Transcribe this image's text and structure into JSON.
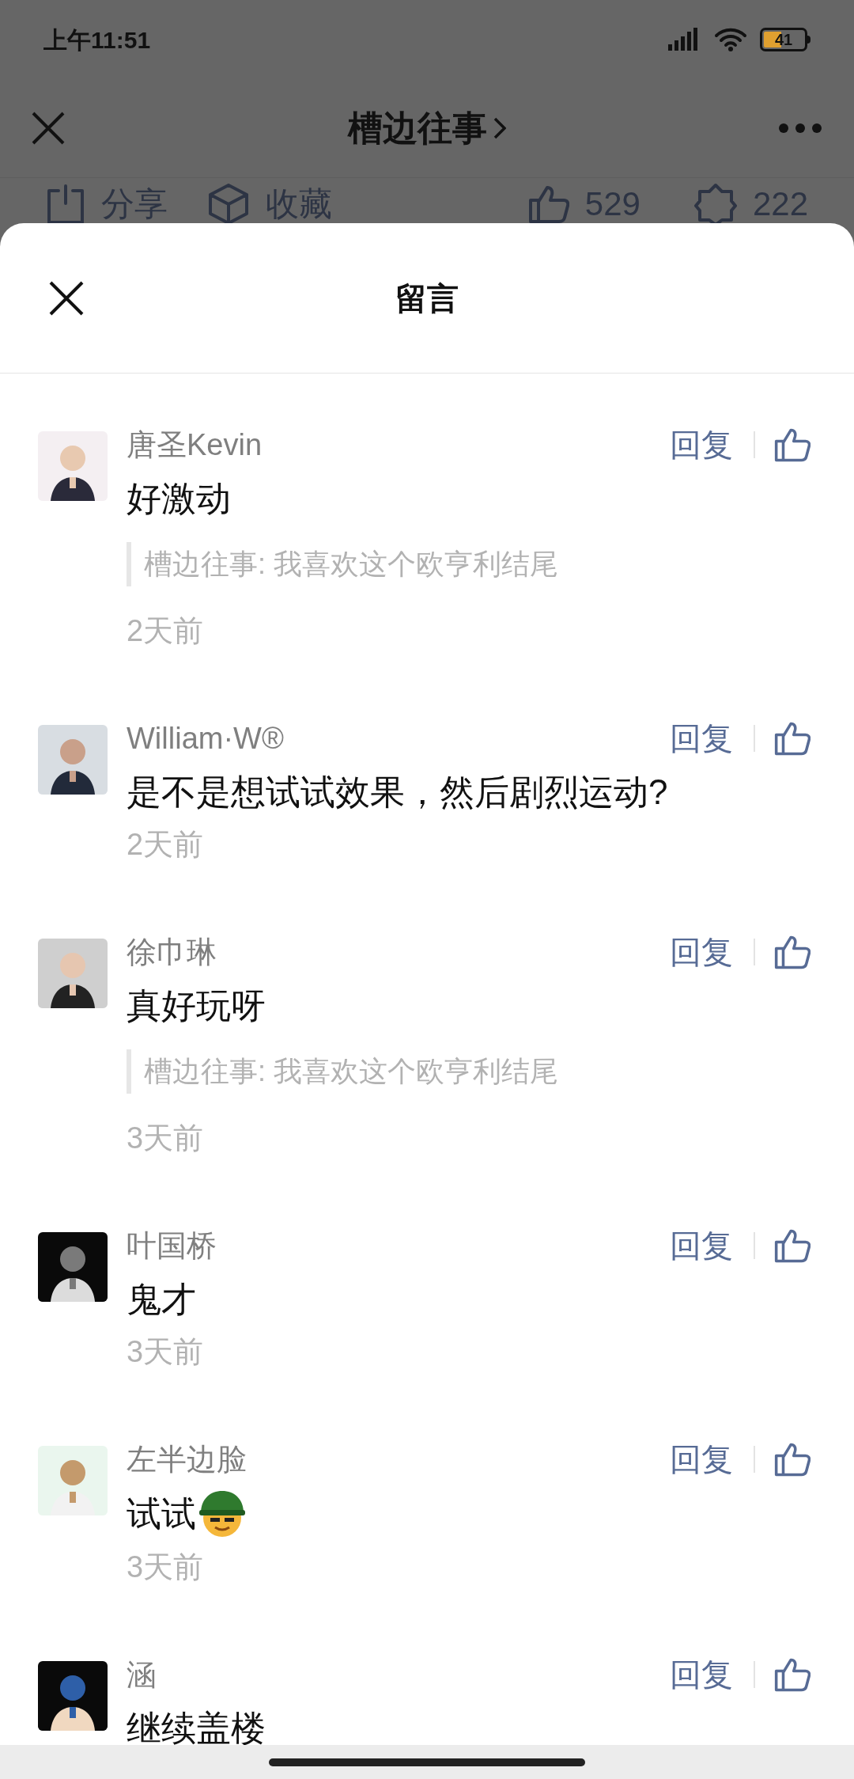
{
  "status_bar": {
    "time": "上午11:51",
    "battery": "41"
  },
  "nav": {
    "title": "槽边往事"
  },
  "actions": [
    {
      "kind": "share",
      "label": "分享"
    },
    {
      "kind": "collect",
      "label": "收藏"
    },
    {
      "kind": "like",
      "label": "529"
    },
    {
      "kind": "wow",
      "label": "222"
    }
  ],
  "sheet": {
    "title": "留言"
  },
  "comments": [
    {
      "name": "唐圣Kevin",
      "text": "好激动",
      "quote": "槽边往事: 我喜欢这个欧亨利结尾",
      "time": "2天前",
      "reply": "回复"
    },
    {
      "name": "William·W®",
      "text": "是不是想试试效果，然后剧烈运动?",
      "time": "2天前",
      "reply": "回复"
    },
    {
      "name": "徐巾琳",
      "text": "真好玩呀",
      "quote": "槽边往事: 我喜欢这个欧亨利结尾",
      "time": "3天前",
      "reply": "回复"
    },
    {
      "name": "叶国桥",
      "text": "鬼才",
      "time": "3天前",
      "reply": "回复"
    },
    {
      "name": "左半边脸",
      "text": "试试",
      "sticker": true,
      "time": "3天前",
      "reply": "回复"
    },
    {
      "name": "涵",
      "text": "继续盖楼",
      "reply": "回复"
    }
  ]
}
